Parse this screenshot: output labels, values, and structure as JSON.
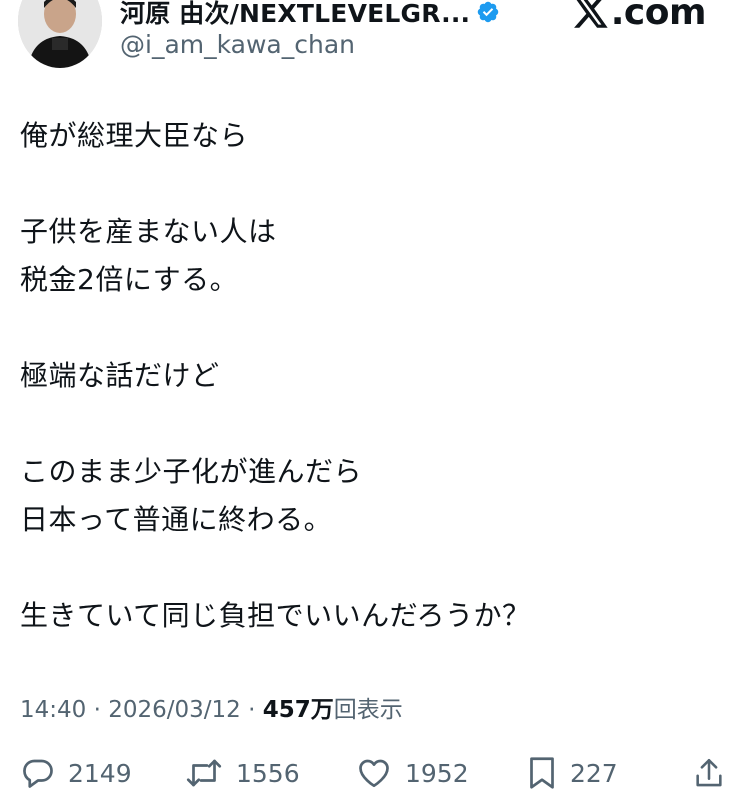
{
  "header": {
    "display_name": "河原 由次/NEXTLEVELGR...",
    "handle": "@i_am_kawa_chan",
    "site_label": ".com"
  },
  "tweet": {
    "lines": [
      "俺が総理大臣なら",
      "",
      "子供を産まない人は",
      "税金2倍にする。",
      "",
      "極端な話だけど",
      "",
      "このまま少子化が進んだら",
      "日本って普通に終わる。",
      "",
      "生きていて同じ負担でいいんだろうか？"
    ]
  },
  "meta": {
    "time": "14:40",
    "sep1": " · ",
    "date": "2026/03/12",
    "sep2": " · ",
    "views_count": "457万",
    "views_label": "回表示"
  },
  "actions": {
    "replies": "2149",
    "reposts": "1556",
    "likes": "1952",
    "bookmarks": "227"
  },
  "colors": {
    "text": "#0f1419",
    "secondary": "#536471",
    "verified": "#1d9bf0"
  },
  "icons": [
    "verified-badge-icon",
    "x-logo-icon",
    "reply-icon",
    "repost-icon",
    "like-icon",
    "bookmark-icon",
    "share-icon"
  ]
}
